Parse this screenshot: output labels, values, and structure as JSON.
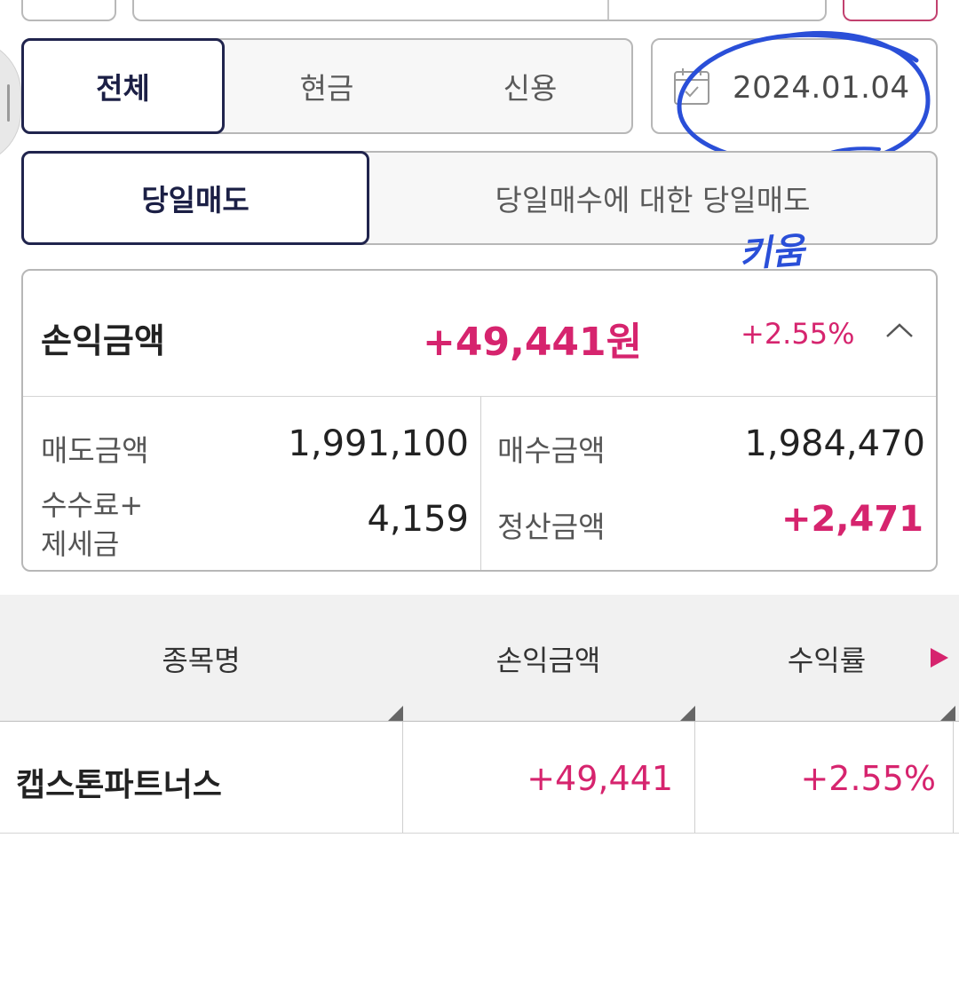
{
  "tabs": {
    "account_types": [
      "전체",
      "현금",
      "신용"
    ],
    "trade_types": [
      "당일매도",
      "당일매수에 대한 당일매도"
    ]
  },
  "date": "2024.01.04",
  "annotation": "키움",
  "summary": {
    "pl_label": "손익금액",
    "pl_value": "+49,441원",
    "pl_rate": "+2.55%",
    "sell_label": "매도금액",
    "sell_value": "1,991,100",
    "buy_label": "매수금액",
    "buy_value": "1,984,470",
    "fee_label_line1": "수수료+",
    "fee_label_line2": "제세금",
    "fee_value": "4,159",
    "settle_label": "정산금액",
    "settle_value": "+2,471"
  },
  "table": {
    "headers": [
      "종목명",
      "손익금액",
      "수익률"
    ],
    "rows": [
      {
        "name": "캡스톤파트너스",
        "pl": "+49,441",
        "rate": "+2.55%"
      }
    ]
  },
  "colors": {
    "accent": "#d6246e",
    "active_border": "#20244d",
    "ink": "#2a4fd8"
  }
}
